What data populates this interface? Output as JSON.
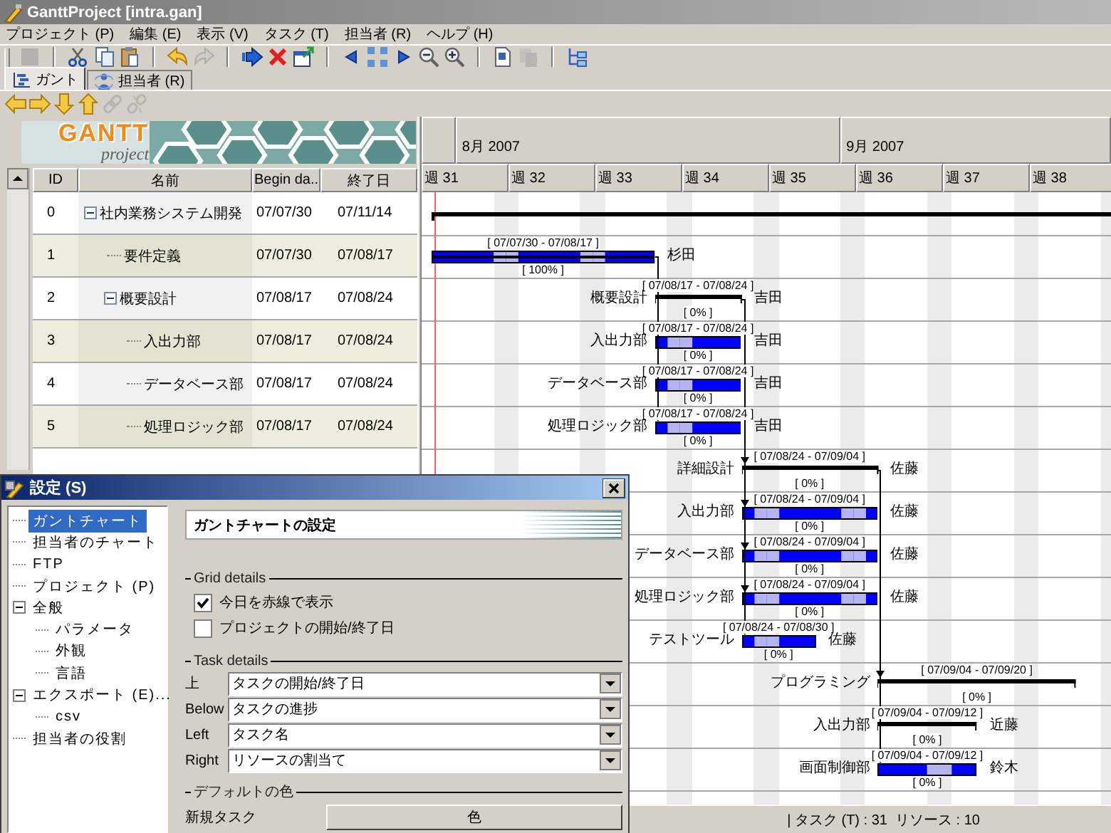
{
  "window": {
    "title": "GanttProject [intra.gan]"
  },
  "menu": [
    "プロジェクト (P)",
    "編集 (E)",
    "表示 (V)",
    "タスク (T)",
    "担当者 (R)",
    "ヘルプ (H)"
  ],
  "toolbar": {
    "groups": [
      {
        "buttons": [
          {
            "kind": "square",
            "disabled": true
          }
        ]
      },
      {
        "buttons": [
          {
            "kind": "cut",
            "disabled": false
          },
          {
            "kind": "copy",
            "disabled": false
          },
          {
            "kind": "paste",
            "disabled": false
          }
        ]
      },
      {
        "buttons": [
          {
            "kind": "undo",
            "disabled": false
          },
          {
            "kind": "redo",
            "disabled": true
          }
        ]
      },
      {
        "buttons": [
          {
            "kind": "indent",
            "disabled": false
          },
          {
            "kind": "delete",
            "disabled": false
          },
          {
            "kind": "new",
            "disabled": false
          }
        ]
      },
      {
        "buttons": [
          {
            "kind": "prev",
            "disabled": false
          },
          {
            "kind": "fit",
            "disabled": false
          },
          {
            "kind": "next",
            "disabled": false
          },
          {
            "kind": "zoomout",
            "disabled": false
          },
          {
            "kind": "zoomin",
            "disabled": false
          }
        ]
      },
      {
        "buttons": [
          {
            "kind": "doc",
            "disabled": false
          },
          {
            "kind": "pages",
            "disabled": true
          }
        ]
      },
      {
        "buttons": [
          {
            "kind": "tree",
            "disabled": false
          }
        ]
      }
    ]
  },
  "tabs": [
    {
      "label": "ガント",
      "kind": "gantt",
      "selected": true
    },
    {
      "label": "担当者 (R)",
      "kind": "people",
      "selected": false
    }
  ],
  "task_toolbar": [
    {
      "kind": "left",
      "disabled": false
    },
    {
      "kind": "right",
      "disabled": false
    },
    {
      "kind": "down",
      "disabled": false
    },
    {
      "kind": "up",
      "disabled": false
    },
    {
      "kind": "link",
      "disabled": true
    },
    {
      "kind": "unlink",
      "disabled": true
    }
  ],
  "logo": {
    "title": "GANTT",
    "subtitle": "project"
  },
  "table": {
    "columns": [
      "ID",
      "名前",
      "Begin da..",
      "終了日"
    ],
    "rows": [
      {
        "id": "0",
        "name": "社内業務システム開発",
        "begin": "07/07/30",
        "end": "07/11/14",
        "expanded": true,
        "children": [
          {
            "id": "1",
            "name": "要件定義",
            "begin": "07/07/30",
            "end": "07/08/17"
          },
          {
            "id": "2",
            "name": "概要設計",
            "begin": "07/08/17",
            "end": "07/08/24",
            "expanded": true,
            "children": [
              {
                "id": "3",
                "name": "入出力部",
                "begin": "07/08/17",
                "end": "07/08/24"
              },
              {
                "id": "4",
                "name": "データベース部",
                "begin": "07/08/17",
                "end": "07/08/24"
              },
              {
                "id": "5",
                "name": "処理ロジック部",
                "begin": "07/08/17",
                "end": "07/08/24"
              }
            ]
          }
        ]
      }
    ]
  },
  "chart": {
    "today_line": true,
    "months": [
      "8月 2007",
      "9月 2007"
    ],
    "weeks": [
      "週 31",
      "週 32",
      "週 33",
      "週 34",
      "週 35",
      "週 36",
      "週 37",
      "週 38"
    ],
    "bars": [
      {
        "kind": "project"
      },
      {
        "kind": "task",
        "level": 1,
        "above": "[ 07/07/30 - 07/08/17 ]",
        "below": "[ 100% ]",
        "right": "杉田"
      },
      {
        "kind": "summary",
        "above": "[ 07/08/17 - 07/08/24 ]",
        "below": "[ 0% ]",
        "left": "概要設計",
        "right": "吉田"
      },
      {
        "kind": "task",
        "above": "[ 07/08/17 - 07/08/24 ]",
        "below": "[ 0% ]",
        "left": "入出力部",
        "right": "吉田"
      },
      {
        "kind": "task",
        "above": "[ 07/08/17 - 07/08/24 ]",
        "below": "[ 0% ]",
        "left": "データベース部",
        "right": "吉田"
      },
      {
        "kind": "task",
        "above": "[ 07/08/17 - 07/08/24 ]",
        "below": "[ 0% ]",
        "left": "処理ロジック部",
        "right": "吉田"
      },
      {
        "kind": "summary",
        "above": "[ 07/08/24 - 07/09/04 ]",
        "below": "[ 0% ]",
        "left": "詳細設計",
        "right": "佐藤"
      },
      {
        "kind": "task",
        "above": "[ 07/08/24 - 07/09/04 ]",
        "below": "[ 0% ]",
        "left": "入出力部",
        "right": "佐藤"
      },
      {
        "kind": "task",
        "above": "[ 07/08/24 - 07/09/04 ]",
        "below": "[ 0% ]",
        "left": "データベース部",
        "right": "佐藤"
      },
      {
        "kind": "task",
        "above": "[ 07/08/24 - 07/09/04 ]",
        "below": "[ 0% ]",
        "left": "処理ロジック部",
        "right": "佐藤"
      },
      {
        "kind": "task",
        "above": "[ 07/08/24 - 07/08/30 ]",
        "below": "[ 0% ]",
        "left": "テストツール",
        "right": "佐藤"
      },
      {
        "kind": "summary",
        "above": "[ 07/09/04 - 07/09/20 ]",
        "below": "[ 0% ]",
        "left": "プログラミング"
      },
      {
        "kind": "summary",
        "above": "[ 07/09/04 - 07/09/12 ]",
        "below": "[ 0% ]",
        "left": "入出力部",
        "right": "近藤"
      },
      {
        "kind": "task",
        "above": "[ 07/09/04 - 07/09/12 ]",
        "below": "[ 0% ]",
        "left": "画面制御部",
        "right": "鈴木"
      }
    ]
  },
  "status_bar": {
    "text": "| タスク (T) : 31  リソース : 10"
  },
  "settings_dialog": {
    "title": "設定 (S)",
    "heading": "ガントチャートの設定",
    "tree": [
      {
        "label": "ガントチャート",
        "selected": true
      },
      {
        "label": "担当者のチャート",
        "selected": false
      },
      {
        "label": "FTP",
        "selected": false
      },
      {
        "label": "プロジェクト (P)",
        "selected": false
      },
      {
        "label": "全般",
        "selected": false,
        "expanded": true,
        "children": [
          {
            "label": "パラメータ",
            "selected": false
          },
          {
            "label": "外観",
            "selected": false
          },
          {
            "label": "言語",
            "selected": false
          }
        ]
      },
      {
        "label": "エクスポート (E)...",
        "selected": false,
        "expanded": true,
        "children": [
          {
            "label": "csv",
            "selected": false
          }
        ]
      },
      {
        "label": "担当者の役割",
        "selected": false
      }
    ],
    "sections": [
      {
        "title": "Grid details",
        "kind": "checks",
        "items": [
          {
            "label": "今日を赤線で表示",
            "checked": true
          },
          {
            "label": "プロジェクトの開始/終了日",
            "checked": false
          }
        ]
      },
      {
        "title": "Task details",
        "kind": "selects",
        "items": [
          {
            "label": "上",
            "value": "タスクの開始/終了日"
          },
          {
            "label": "Below",
            "value": "タスクの進捗"
          },
          {
            "label": "Left",
            "value": "タスク名"
          },
          {
            "label": "Right",
            "value": "リソースの割当て"
          }
        ]
      },
      {
        "title": "デフォルトの色",
        "kind": "colors",
        "items": [
          {
            "label": "新規タスク",
            "button": "色"
          }
        ]
      }
    ]
  }
}
